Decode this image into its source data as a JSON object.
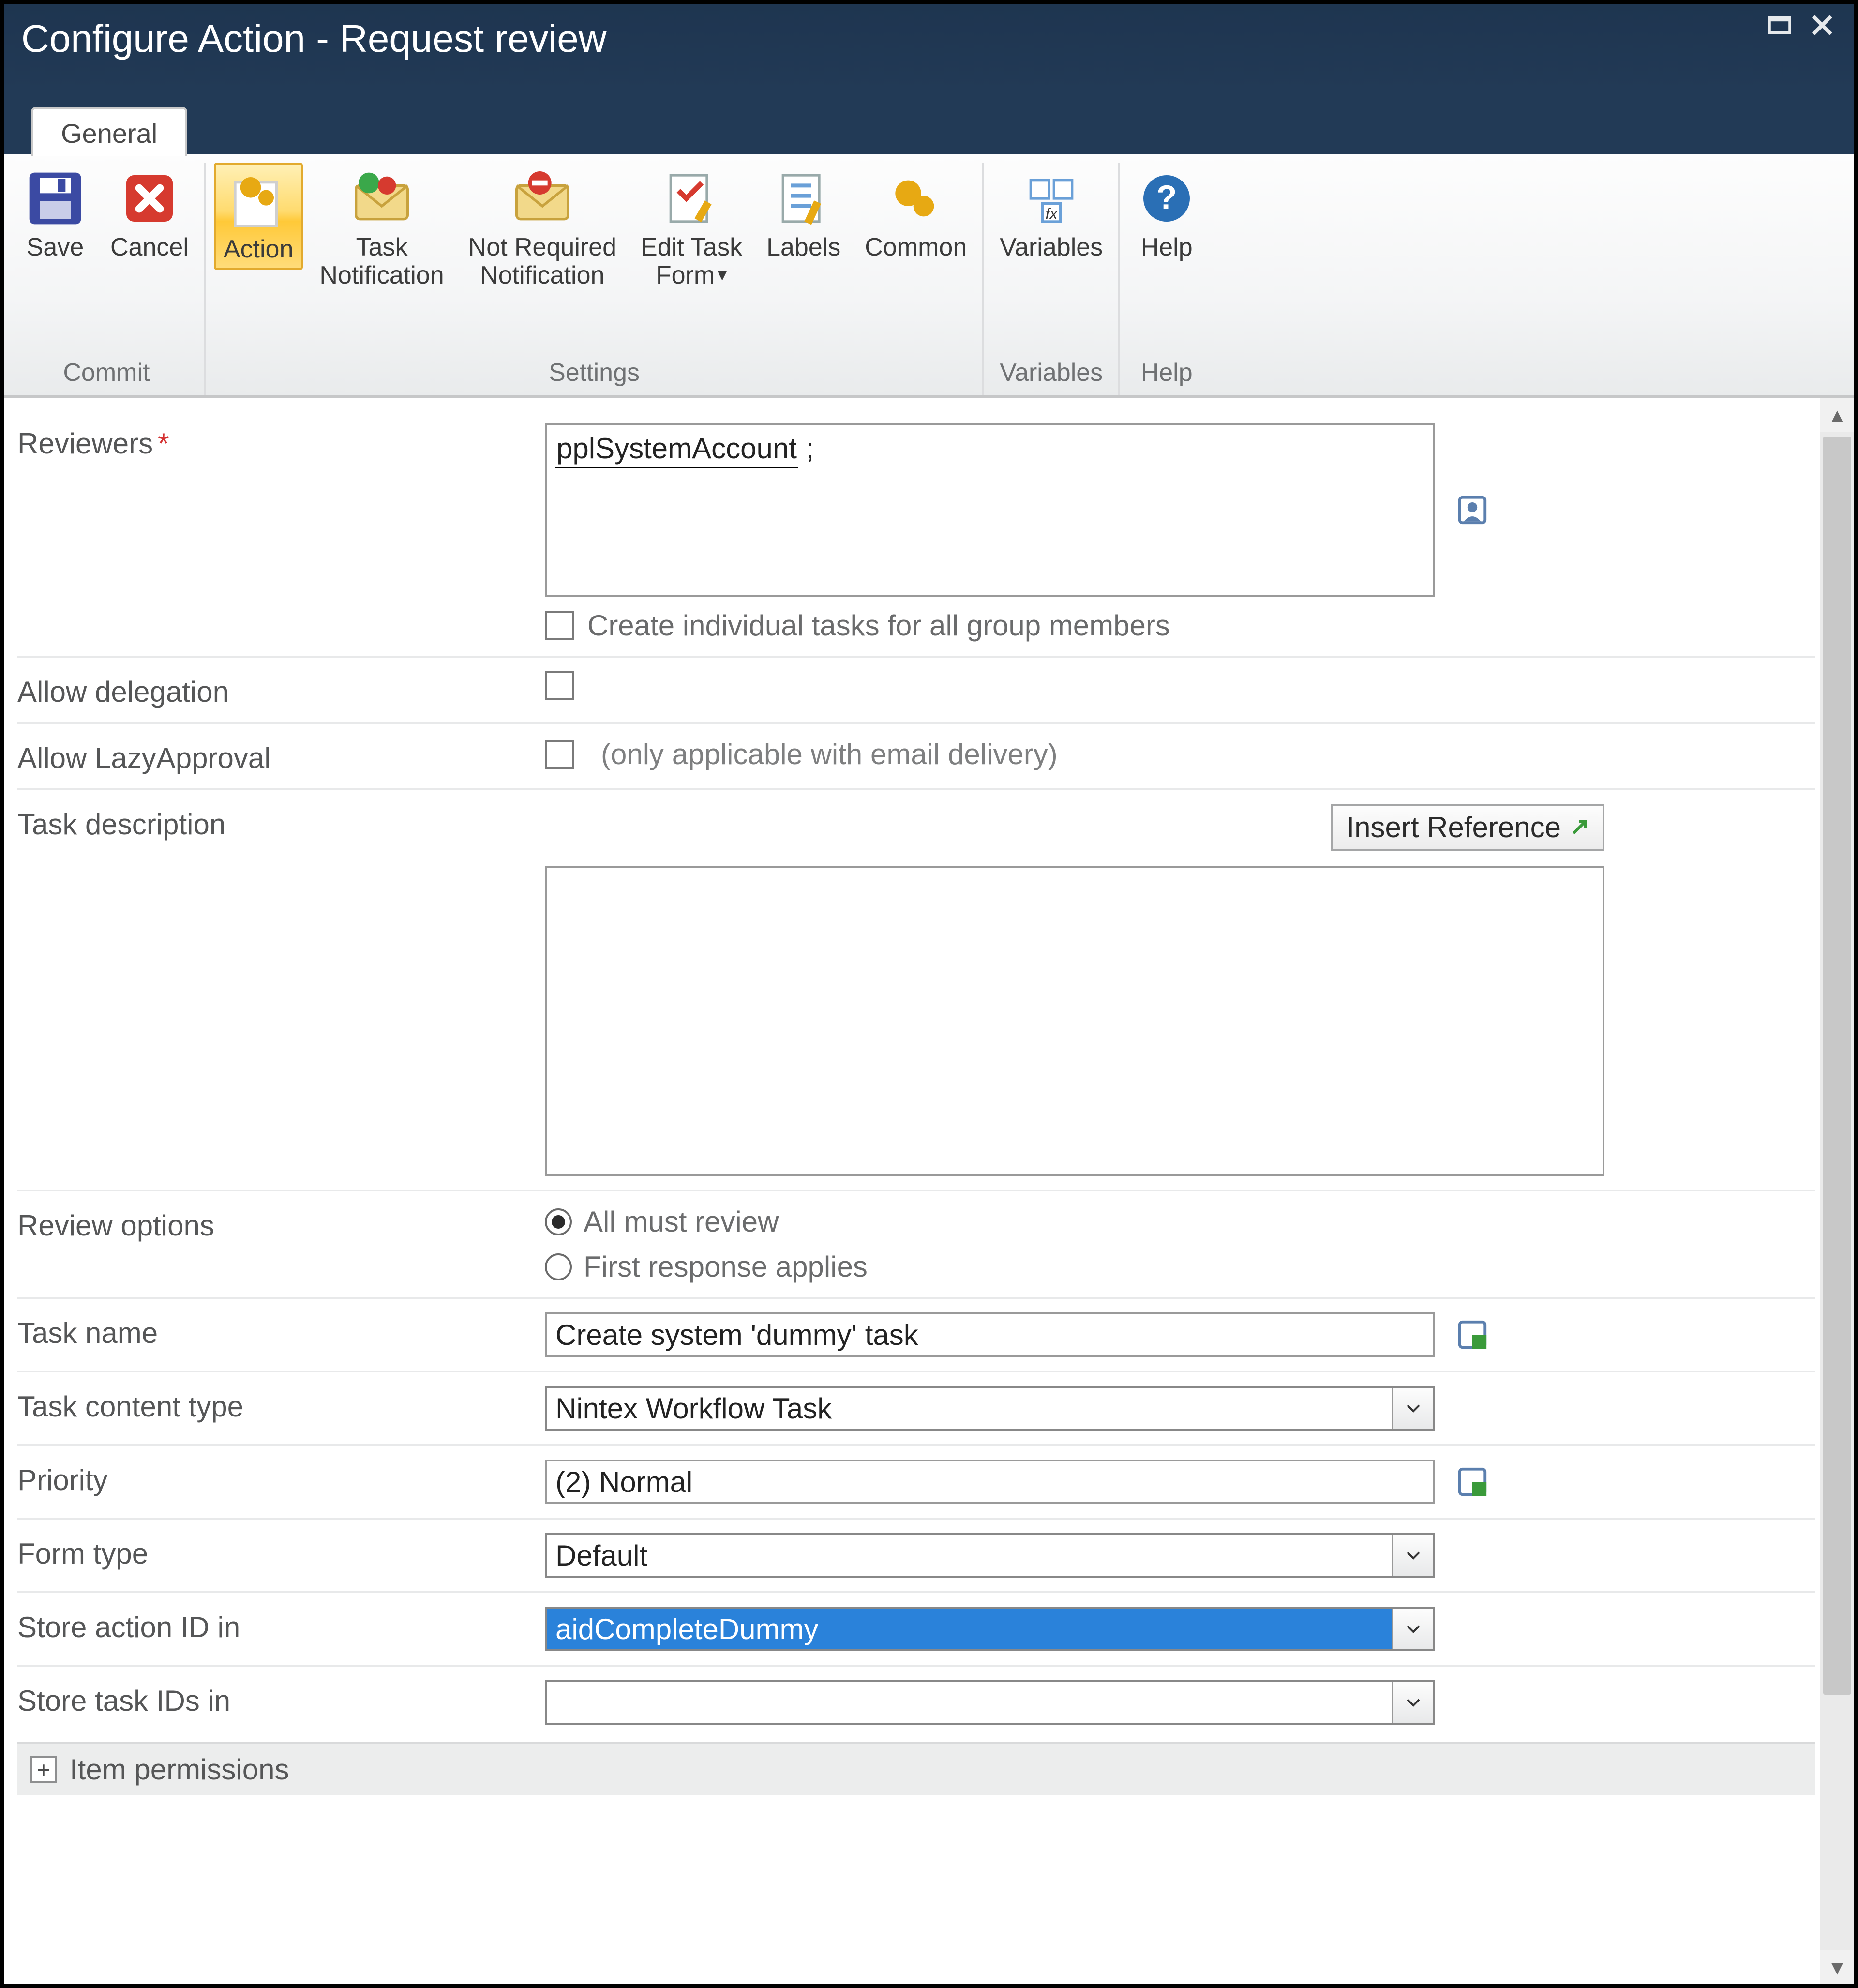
{
  "window": {
    "title": "Configure Action - Request review"
  },
  "tabs": {
    "general": "General"
  },
  "ribbon": {
    "groups": {
      "commit": {
        "label": "Commit"
      },
      "settings": {
        "label": "Settings"
      },
      "variables": {
        "label": "Variables"
      },
      "help": {
        "label": "Help"
      }
    },
    "buttons": {
      "save": "Save",
      "cancel": "Cancel",
      "action": "Action",
      "taskNotification": "Task\nNotification",
      "notRequiredNotification": "Not Required\nNotification",
      "editTaskForm": "Edit Task\nForm",
      "labels": "Labels",
      "common": "Common",
      "variables": "Variables",
      "help": "Help"
    }
  },
  "form": {
    "reviewers": {
      "label": "Reviewers",
      "required": "*",
      "value": "pplSystemAccount",
      "separator": " ;",
      "createIndividualTasks": "Create individual tasks for all group members"
    },
    "allowDelegation": {
      "label": "Allow delegation"
    },
    "allowLazy": {
      "label": "Allow LazyApproval",
      "hint": "(only applicable with email delivery)"
    },
    "taskDescription": {
      "label": "Task description",
      "insertReference": "Insert Reference"
    },
    "reviewOptions": {
      "label": "Review options",
      "opt1": "All must review",
      "opt2": "First response applies"
    },
    "taskName": {
      "label": "Task name",
      "value": "Create system 'dummy' task"
    },
    "taskContentType": {
      "label": "Task content type",
      "value": "Nintex Workflow Task"
    },
    "priority": {
      "label": "Priority",
      "value": "(2) Normal"
    },
    "formType": {
      "label": "Form type",
      "value": "Default"
    },
    "storeActionId": {
      "label": "Store action ID in",
      "value": "aidCompleteDummy"
    },
    "storeTaskIds": {
      "label": "Store task IDs in",
      "value": ""
    },
    "itemPermissions": {
      "label": "Item permissions",
      "expand": "+"
    }
  }
}
